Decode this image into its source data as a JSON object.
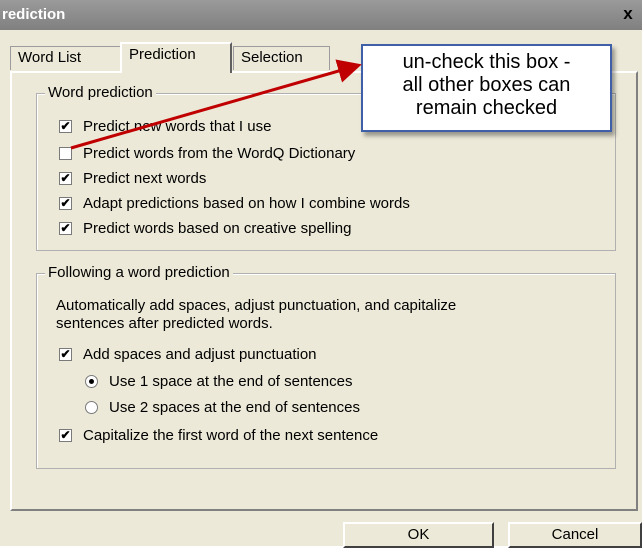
{
  "window": {
    "title": "rediction",
    "close_glyph": "x"
  },
  "tabs": [
    {
      "label": "Word List",
      "active": false
    },
    {
      "label": "Prediction",
      "active": true
    },
    {
      "label": "Selection",
      "active": false
    }
  ],
  "word_prediction": {
    "legend": "Word prediction",
    "options": [
      {
        "label": "Predict new words that I use",
        "checked": true
      },
      {
        "label": "Predict words from the WordQ Dictionary",
        "checked": false
      },
      {
        "label": "Predict next words",
        "checked": true
      },
      {
        "label": "Adapt predictions based on how I combine words",
        "checked": true
      },
      {
        "label": "Predict words based on creative spelling",
        "checked": true
      }
    ]
  },
  "following": {
    "legend": "Following a word prediction",
    "description_line1": "Automatically add spaces, adjust punctuation, and capitalize",
    "description_line2": "sentences after predicted words.",
    "add_spaces": {
      "label": "Add spaces and adjust punctuation",
      "checked": true
    },
    "radio_options": [
      {
        "label": "Use 1 space at the end of sentences",
        "selected": true
      },
      {
        "label": "Use 2 spaces at the end of sentences",
        "selected": false
      }
    ],
    "capitalize": {
      "label": "Capitalize the first word of the next sentence",
      "checked": true
    }
  },
  "buttons": {
    "ok": "OK",
    "cancel": "Cancel"
  },
  "callout": {
    "line1": "un-check this box -",
    "line2": "all other boxes can",
    "line3": "remain checked",
    "border_color": "#3f5fa8",
    "arrow_color": "#c00000"
  }
}
